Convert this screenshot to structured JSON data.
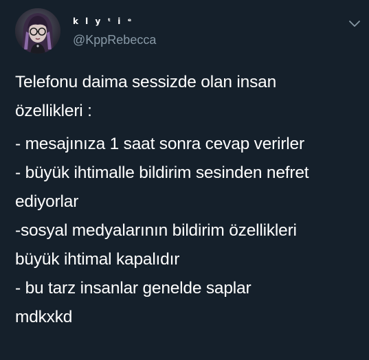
{
  "tweet": {
    "author": {
      "display_name": "k l y ᵗ i ᵉ",
      "handle": "@KppRebecca",
      "avatar_icon": "profile-avatar"
    },
    "menu_icon": "chevron-down-icon",
    "text_lines": [
      "Telefonu daima sessizde olan insan",
      "özellikleri :",
      "- mesajınıza 1 saat sonra cevap verirler",
      "- büyük ihtimalle bildirim sesinden nefret",
      "ediyorlar",
      "-sosyal medyalarının bildirim özellikleri",
      "büyük ihtimal kapalıdır",
      "- bu tarz insanlar genelde saplar",
      "mdkxkd"
    ]
  },
  "colors": {
    "background": "#15202b",
    "primary_text": "#ffffff",
    "secondary_text": "#8899a6"
  }
}
